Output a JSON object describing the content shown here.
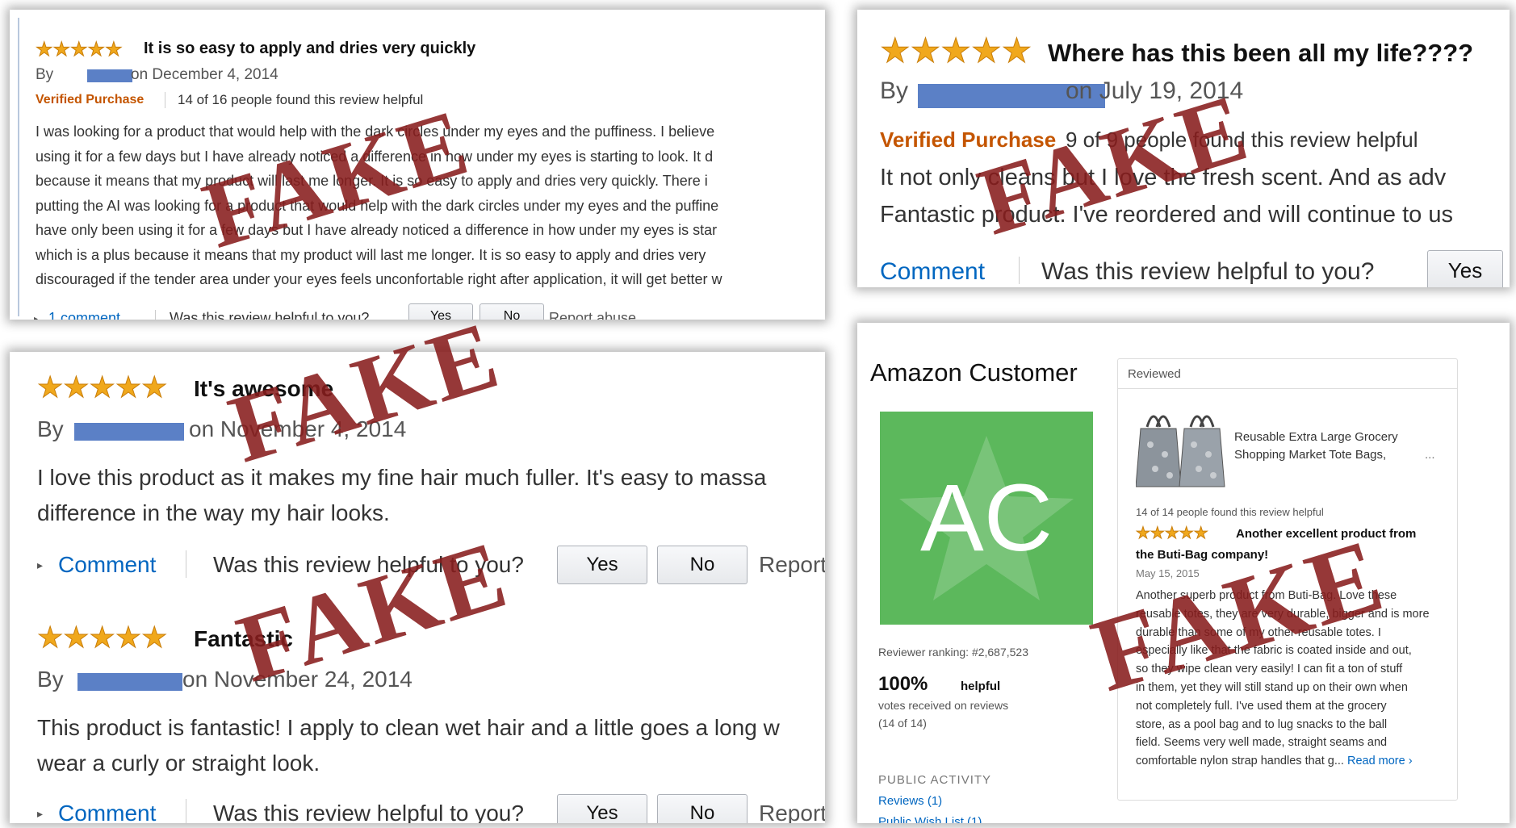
{
  "stars": "★★★★★",
  "fake_label": "FAKE",
  "panel1": {
    "title": "It is so easy to apply and dries very quickly",
    "by": "By",
    "date": "on December 4, 2014",
    "verified": "Verified Purchase",
    "helpful": "14 of 16 people found this review helpful",
    "body": [
      "I was looking for a product that would help with the dark circles under my eyes and the puffiness. I believe",
      "using it for a few days but I have already noticed a difference in how under my eyes is starting to look. It d",
      "because it means that my product will last me longer. It is so easy to apply and dries very quickly. There i",
      "putting the AI was looking for a product that would help with the dark circles under my eyes and the puffine",
      "have only been using it for a few days but I have already noticed a difference in how under my eyes is star",
      "which is a plus because it means that my product will last me longer. It is so easy to apply and dries very",
      "discouraged if the tender area under your eyes feels unconfortable right after application, it will get better w"
    ],
    "comment": "1 comment",
    "question": "Was this review helpful to you?",
    "yes": "Yes",
    "no": "No",
    "report": "Report abuse"
  },
  "panel2": {
    "title": "Where has this been all my life????",
    "by": "By",
    "date": "on July 19, 2014",
    "verified": "Verified Purchase",
    "helpful": "9 of 9 people found this review helpful",
    "body": [
      "It not only cleans but I love the fresh scent. And as adv",
      "Fantastic product. I've reordered and will continue to us"
    ],
    "comment": "Comment",
    "question": "Was this review helpful to you?",
    "yes": "Yes"
  },
  "panel3": {
    "review1": {
      "title": "It's awesome",
      "by": "By",
      "date": "on November 4, 2014",
      "body": [
        "I love this product as it makes my fine hair much fuller. It's easy to massa",
        "difference in the way my hair looks."
      ],
      "comment": "Comment",
      "question": "Was this review helpful to you?",
      "yes": "Yes",
      "no": "No",
      "report": "Report"
    },
    "review2": {
      "title": "Fantastic",
      "by": "By",
      "date": "on November 24, 2014",
      "body": [
        "This product is fantastic! I apply to clean wet hair and a little goes a long w",
        "wear a curly or straight look."
      ],
      "comment": "Comment",
      "question": "Was this review helpful to you?",
      "yes": "Yes",
      "no": "No",
      "report": "Report"
    }
  },
  "panel4": {
    "name": "Amazon Customer",
    "avatar": "AC",
    "avatar_color": "#5cb85c",
    "ranking": "Reviewer ranking: #2,687,523",
    "helpful_pct": "100%",
    "helpful_word": "helpful",
    "votes": "votes received on reviews",
    "votes_count": "(14 of 14)",
    "public_activity": "PUBLIC ACTIVITY",
    "reviews_link": "Reviews (1)",
    "wishlist_link": "Public Wish List (1)",
    "reviewed_label": "Reviewed",
    "product": [
      "Reusable Extra Large Grocery",
      "Shopping Market Tote Bags,"
    ],
    "product_more": "...",
    "review_helpful": "14 of 14 people found this review helpful",
    "review_title": [
      "Another excellent product from",
      "the Buti-Bag company!"
    ],
    "review_date": "May 15, 2015",
    "review_body": [
      "Another superb product from Buti-Bag. Love these",
      "reusable totes, they are very durable, bigger and is more",
      "durable than some of my other reusable totes. I",
      "especially like that the fabric is coated inside and out,",
      "so they wipe clean very easily! I can fit a ton of stuff",
      "in them, yet they will still stand up on their own when",
      "not completely full. I've used them at the grocery",
      "store, as a pool bag and to lug snacks to the ball",
      "field. Seems very well made, straight seams and",
      "comfortable nylon strap handles that g..."
    ],
    "read_more": "Read more",
    "read_more_arrow": "›"
  }
}
